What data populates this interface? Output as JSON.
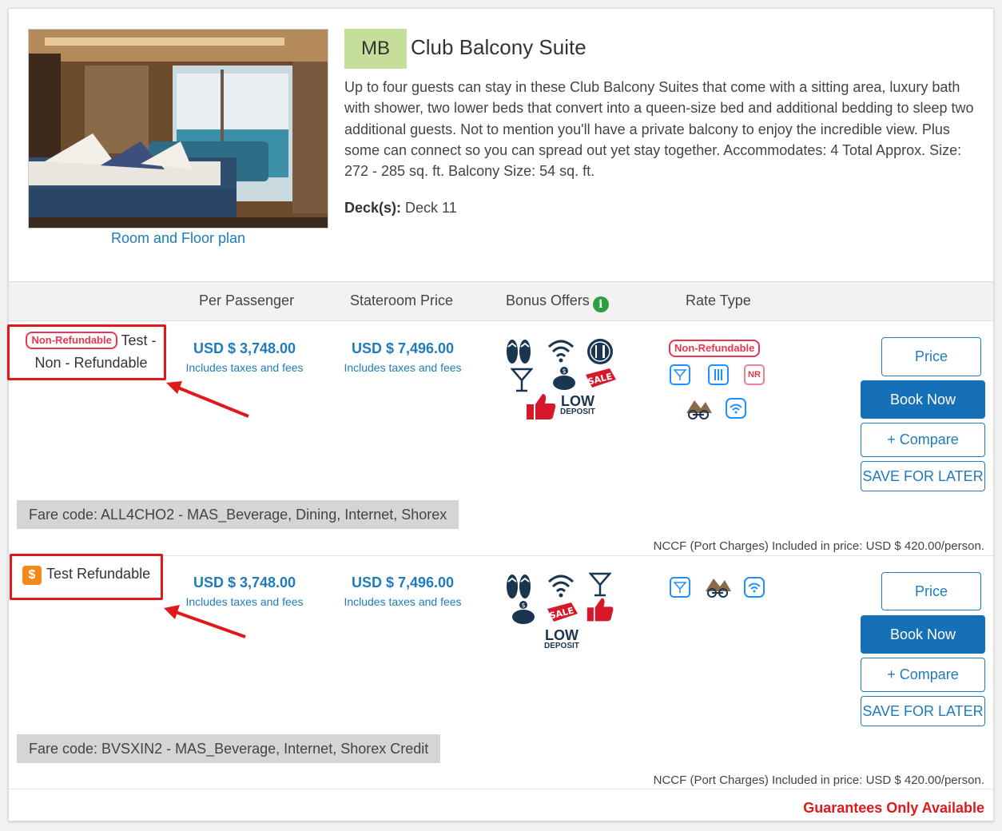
{
  "room": {
    "code": "MB",
    "title": "Club Balcony Suite",
    "description": "Up to four guests can stay in these Club Balcony Suites that come with a sitting area, luxury bath with shower, two lower beds that convert into a queen-size bed and additional bedding to sleep two additional guests. Not to mention you'll have a private balcony to enjoy the incredible view. Plus some can connect so you can spread out yet stay together. Accommodates: 4 Total Approx. Size: 272 - 285 sq. ft. Balcony Size: 54 sq. ft.",
    "deck_label": "Deck(s):",
    "deck_value": " Deck 11",
    "floor_plan_link": "Room and Floor plan"
  },
  "table_headers": {
    "per_passenger": "Per Passenger",
    "stateroom_price": "Stateroom Price",
    "bonus_offers": "Bonus Offers",
    "rate_type": "Rate Type"
  },
  "rates": [
    {
      "tag": "Non-Refundable",
      "name_part1": "Test -",
      "name_part2": "Non - Refundable",
      "per_passenger": "USD $ 3,748.00",
      "per_passenger_note": "Includes taxes and fees",
      "stateroom": "USD $ 7,496.00",
      "stateroom_note": "Includes taxes and fees",
      "bonus_icons": [
        "flip-flops-icon",
        "wifi-icon",
        "dining-icon",
        "cocktail-icon",
        "piggy-bank-icon",
        "sale-icon",
        "thumbs-up-icon",
        "low-deposit-icon"
      ],
      "rate_type_tag": "Non-Refundable",
      "rate_type_icons": [
        "beverage-icon",
        "dining-icon",
        "nr-icon",
        "shore-excursion-icon",
        "wifi-icon"
      ],
      "fare_code": "Fare code: ALL4CHO2 - MAS_Beverage, Dining, Internet, Shorex",
      "nccf": "NCCF (Port Charges) Included in price: USD $ 420.00/person."
    },
    {
      "tag_icon": "$",
      "name_part1": "Test Refundable",
      "per_passenger": "USD $ 3,748.00",
      "per_passenger_note": "Includes taxes and fees",
      "stateroom": "USD $ 7,496.00",
      "stateroom_note": "Includes taxes and fees",
      "bonus_icons": [
        "flip-flops-icon",
        "wifi-icon",
        "cocktail-icon",
        "piggy-bank-icon",
        "sale-icon",
        "thumbs-up-icon",
        "low-deposit-icon"
      ],
      "rate_type_icons": [
        "beverage-icon",
        "shore-excursion-icon",
        "wifi-icon"
      ],
      "fare_code": "Fare code: BVSXIN2 - MAS_Beverage, Internet, Shorex Credit",
      "nccf": "NCCF (Port Charges) Included in price: USD $ 420.00/person."
    }
  ],
  "buttons": {
    "price": "Price",
    "book_now": "Book Now",
    "compare": "+ Compare",
    "save_for_later": "SAVE FOR LATER"
  },
  "low_deposit": {
    "line1": "LOW",
    "line2": "DEPOSIT"
  },
  "sale_label": "SALE",
  "nr_label": "NR",
  "footer": {
    "guarantee": "Guarantees Only Available"
  },
  "colors": {
    "accent_blue": "#1f7bbd",
    "primary_button": "#1570b8",
    "badge_green": "#c5df9a",
    "alert_red": "#e01a1a",
    "nr_pink": "#e8384f",
    "dollar_orange": "#f08a1d",
    "icon_navy": "#1a3550"
  }
}
